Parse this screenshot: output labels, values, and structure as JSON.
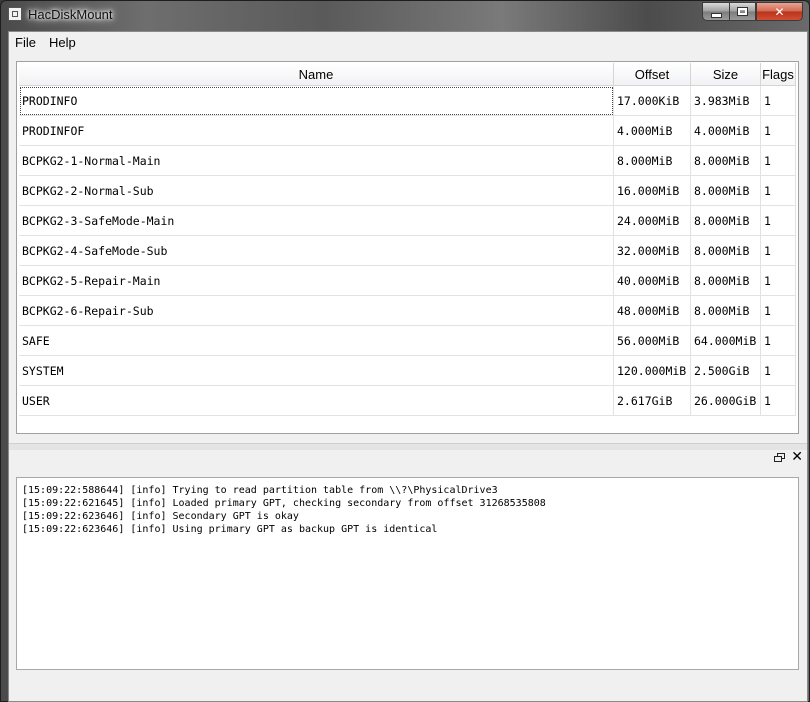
{
  "window": {
    "title": "HacDiskMount"
  },
  "menu": {
    "file": "File",
    "help": "Help"
  },
  "table": {
    "headers": {
      "name": "Name",
      "offset": "Offset",
      "size": "Size",
      "flags": "Flags"
    },
    "rows": [
      {
        "name": "PRODINFO",
        "offset": "17.000KiB",
        "size": "3.983MiB",
        "flags": "1"
      },
      {
        "name": "PRODINFOF",
        "offset": "4.000MiB",
        "size": "4.000MiB",
        "flags": "1"
      },
      {
        "name": "BCPKG2-1-Normal-Main",
        "offset": "8.000MiB",
        "size": "8.000MiB",
        "flags": "1"
      },
      {
        "name": "BCPKG2-2-Normal-Sub",
        "offset": "16.000MiB",
        "size": "8.000MiB",
        "flags": "1"
      },
      {
        "name": "BCPKG2-3-SafeMode-Main",
        "offset": "24.000MiB",
        "size": "8.000MiB",
        "flags": "1"
      },
      {
        "name": "BCPKG2-4-SafeMode-Sub",
        "offset": "32.000MiB",
        "size": "8.000MiB",
        "flags": "1"
      },
      {
        "name": "BCPKG2-5-Repair-Main",
        "offset": "40.000MiB",
        "size": "8.000MiB",
        "flags": "1"
      },
      {
        "name": "BCPKG2-6-Repair-Sub",
        "offset": "48.000MiB",
        "size": "8.000MiB",
        "flags": "1"
      },
      {
        "name": "SAFE",
        "offset": "56.000MiB",
        "size": "64.000MiB",
        "flags": "1"
      },
      {
        "name": "SYSTEM",
        "offset": "120.000MiB",
        "size": "2.500GiB",
        "flags": "1"
      },
      {
        "name": "USER",
        "offset": "2.617GiB",
        "size": "26.000GiB",
        "flags": "1"
      }
    ]
  },
  "log": {
    "lines": [
      "[15:09:22:588644] [info] Trying to read partition table from \\\\?\\PhysicalDrive3",
      "[15:09:22:621645] [info] Loaded primary GPT, checking secondary from offset 31268535808",
      "[15:09:22:623646] [info] Secondary GPT is okay",
      "[15:09:22:623646] [info] Using primary GPT as backup GPT is identical"
    ]
  },
  "icons": {
    "app": "app-icon",
    "minimize": "minimize-icon",
    "maximize": "maximize-icon",
    "close": "close-icon",
    "dock_float": "float-icon",
    "dock_close": "close-icon"
  },
  "colors": {
    "close_button": "#c9452b",
    "client_bg": "#f0f0f0"
  }
}
